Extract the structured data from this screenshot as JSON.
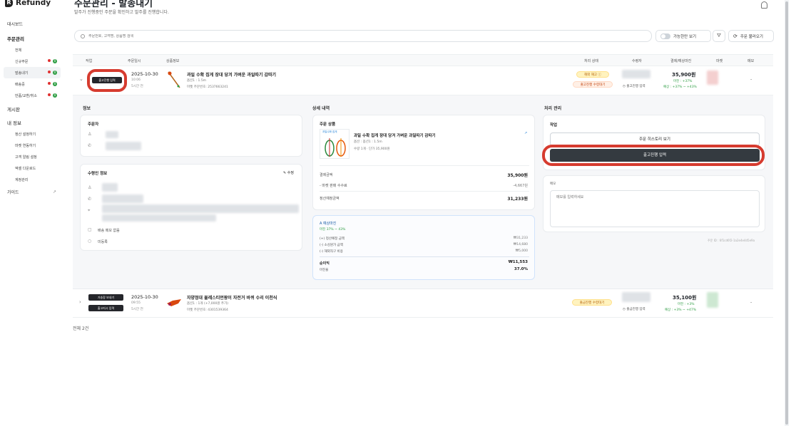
{
  "brand": {
    "name": "Refundy"
  },
  "sidebar": {
    "items": [
      {
        "label": "대시보드"
      },
      {
        "label": "주문관리"
      },
      {
        "label": "전체"
      },
      {
        "label": "신규주문"
      },
      {
        "label": "발송내기"
      },
      {
        "label": "배송중"
      },
      {
        "label": "반품/교환/취소"
      },
      {
        "label": "게시판"
      },
      {
        "label": "내 정보"
      },
      {
        "label": "정산 설정하기"
      },
      {
        "label": "마켓 연동하기"
      },
      {
        "label": "고객 알림 설정"
      },
      {
        "label": "엑셀 다운로드"
      },
      {
        "label": "계정관리"
      },
      {
        "label": "가이드"
      }
    ],
    "badge_count": "0"
  },
  "header": {
    "title": "주문관리 - 발송내기",
    "subtitle": "발주가 진행중인 주문을 확인하고 발주를 진행합니다.",
    "search_placeholder": "주문번호, 고객명, 상품명 검색",
    "toggle_label": "가능한만 보기",
    "refresh_label": "주문 불러오기"
  },
  "table": {
    "headers": [
      "작업",
      "주문일시",
      "상품정보",
      "처리 상태",
      "수령자",
      "결제/예상마진",
      "마켓",
      "메모"
    ]
  },
  "orders": [
    {
      "action1": "출고진행 입력",
      "date": "2025-10-30",
      "time": "10:06",
      "ago": "5시간 전",
      "product": "과일 수확 집게 장대 당겨 가벼운 과일따기 감따기",
      "option": "옵션1 : 1.5m",
      "code": "마켓 주문번호: 2537663241",
      "status1": "해외 재고",
      "status2": "출고진행 수령대기",
      "recipient_note": "출고진행 입력",
      "amount": "35,900원",
      "margin1": "마진 : +37%",
      "margin2": "예상 : +37% ~ +43%",
      "memo": "-"
    },
    {
      "action1": "가송장 보내기",
      "action2": "출고지시 입력",
      "date": "2025-10-30",
      "time": "09:55",
      "ago": "5시간 전",
      "product": "자양정대 물레스티먼팡이 자전거 바퀴 수리 이천식",
      "option": "옵션1 : 1개 (+7,000원 추가)",
      "code": "마켓 주문번호: 4301539364",
      "status1": "출금진행 수령대기",
      "recipient_note": "출금진행 입력",
      "amount": "35,100원",
      "margin1": "마진 : +3%",
      "margin2": "예상 : +3% ~ +47%",
      "memo": "-"
    }
  ],
  "detail": {
    "info_title": "정보",
    "orderer_label": "주문자",
    "receiver_label": "수령인 정보",
    "edit_label": "수정",
    "customs_label": "배송 메모 없음",
    "address_note": "미등록",
    "detail_title": "상세 내역",
    "order_item_label": "주문 상품",
    "item_name": "과일 수확 집게 장대 당겨 가벼운 과일따기 감따기",
    "item_option": "옵션 : 옵션1 : 1.5m",
    "item_qty": "수량 1개 · 단가 35,900원",
    "thumb_label": "과일수확 집게",
    "pay_label": "결제금액",
    "pay_value": "35,900원",
    "fee_label": "- 마켓 판매 수수료",
    "fee_value": "-4,667원",
    "settle_label": "정산예정금액",
    "settle_value": "31,233원",
    "margin_title": "A 예상마진",
    "margin_range": "마진 37% ~ 43%",
    "m_rows": [
      {
        "label": "(+) 정산예정 금액",
        "value": "₩31,233"
      },
      {
        "label": "(-) 소싱원가 금액",
        "value": "₩14,680"
      },
      {
        "label": "(-) 해외직구 비용",
        "value": "₩5,000"
      }
    ],
    "net_label": "순이익",
    "net_value": "₩11,553",
    "rate_label": "마진율",
    "rate_value": "37.0%",
    "process_title": "처리 관리",
    "action_label": "작업",
    "view_btn": "주문 히스토리 보기",
    "ship_btn": "출고진행 입력",
    "memo_label": "메모",
    "memo_placeholder": "메모를 입력하세요",
    "order_id_label": "주문 ID : 6f1cd6f2-1a2e4e4d5e9a"
  },
  "footer": {
    "total": "전체 2건"
  }
}
